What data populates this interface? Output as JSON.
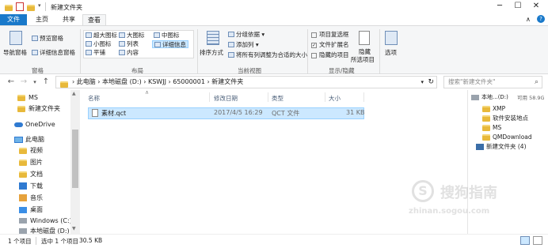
{
  "window": {
    "title": "新建文件夹"
  },
  "ribbon_tabs": [
    "文件",
    "主页",
    "共享",
    "查看"
  ],
  "ribbon": {
    "nav_pane": "导航窗格",
    "preview_pane": "预览窗格",
    "details_pane": "详细信息窗格",
    "pane_group": "窗格",
    "layout_items": [
      "超大图标",
      "大图标",
      "中图标",
      "小图标",
      "列表",
      "详细信息",
      "平铺",
      "内容"
    ],
    "layout_group": "布局",
    "sort": "排序方式",
    "group_by": "分组依据",
    "add_column": "添加列",
    "fit_columns": "将所有列调整为合适的大小",
    "view_group": "当前视图",
    "item_checkbox": "项目复选框",
    "file_ext": "文件扩展名",
    "hidden_items": "隐藏的项目",
    "hide_selected": "隐藏\n所选项目",
    "showhide_group": "显示/隐藏",
    "options": "选项"
  },
  "address": {
    "path": [
      "此电脑",
      "本地磁盘 (D:)",
      "KSWJJ",
      "65000001",
      "新建文件夹"
    ],
    "search_placeholder": "搜索\"新建文件夹\""
  },
  "nav_items": [
    {
      "label": "MS",
      "kind": "folder"
    },
    {
      "label": "新建文件夹",
      "kind": "folder"
    },
    {
      "label": "OneDrive",
      "kind": "cloud"
    },
    {
      "label": "此电脑",
      "kind": "pc"
    },
    {
      "label": "视频",
      "kind": "folder"
    },
    {
      "label": "图片",
      "kind": "folder"
    },
    {
      "label": "文档",
      "kind": "folder"
    },
    {
      "label": "下载",
      "kind": "folder"
    },
    {
      "label": "音乐",
      "kind": "folder"
    },
    {
      "label": "桌面",
      "kind": "folder"
    },
    {
      "label": "Windows (C:)",
      "kind": "drive"
    },
    {
      "label": "本地磁盘 (D:)",
      "kind": "drive"
    }
  ],
  "columns": [
    "名称",
    "修改日期",
    "类型",
    "大小"
  ],
  "files": [
    {
      "name": "素材.qct",
      "date": "2017/4/5 16:29",
      "type": "QCT 文件",
      "size": "31 KB"
    }
  ],
  "preview": {
    "drive": "本地...",
    "drive_paren": "(D:)",
    "free": "可用 58.9G",
    "items": [
      "XMP",
      "软件安装地点",
      "MS",
      "QMDownload",
      "新建文件夹 (4)"
    ]
  },
  "status": {
    "count": "1 个项目",
    "selected": "选中 1 个项目",
    "size": "30.5 KB"
  },
  "watermark": {
    "brand": "搜狗指南",
    "url": "zhinan.sogou.com"
  },
  "colors": {
    "accent": "#1979ca",
    "selection": "#cce8ff"
  }
}
